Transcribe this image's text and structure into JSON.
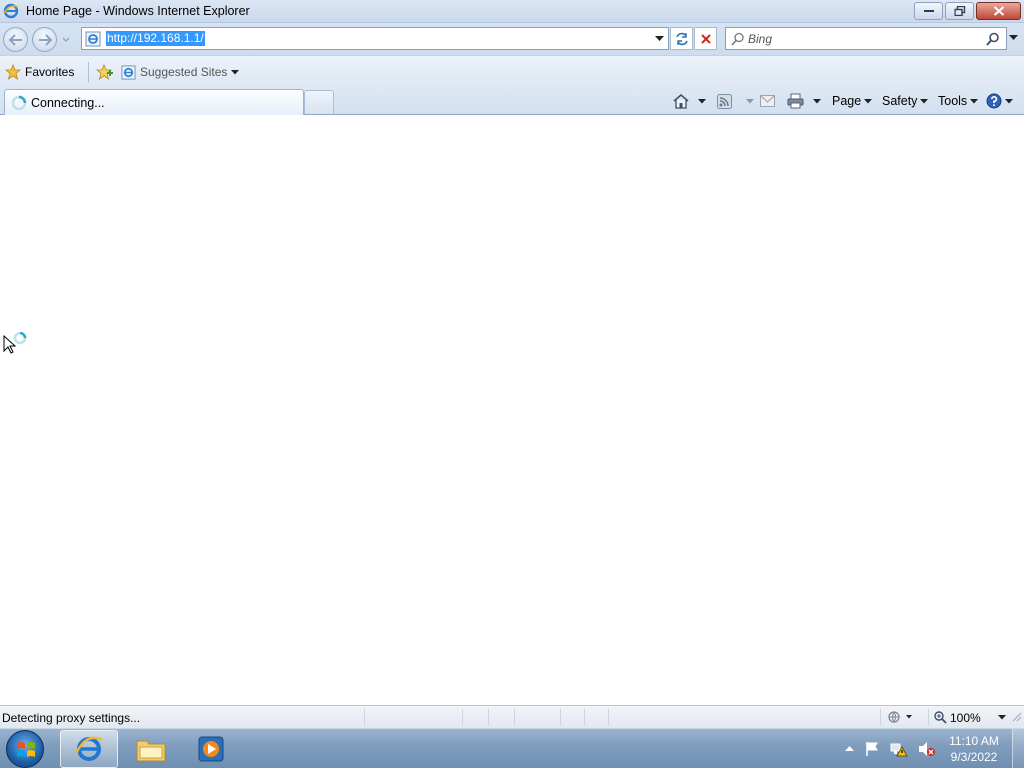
{
  "window": {
    "title": "Home Page - Windows Internet Explorer",
    "minimize_icon": "minimize-icon",
    "restore_icon": "restore-icon",
    "close_icon": "close-icon"
  },
  "navigation": {
    "back_icon": "back-arrow-icon",
    "forward_icon": "forward-arrow-icon",
    "address_url": "http://192.168.1.1/",
    "refresh_icon": "refresh-icon",
    "stop_icon": "stop-icon",
    "search_placeholder": "Bing"
  },
  "favorites_bar": {
    "favorites_label": "Favorites",
    "suggested_sites_label": "Suggested Sites"
  },
  "tabs": [
    {
      "label": "Connecting...",
      "active": true
    }
  ],
  "command_bar": {
    "page_label": "Page",
    "safety_label": "Safety",
    "tools_label": "Tools"
  },
  "status_bar": {
    "status_text": "Detecting proxy settings...",
    "zoom_level": "100%"
  },
  "taskbar": {
    "clock_time": "11:10 AM",
    "clock_date": "9/3/2022",
    "pinned_apps": [
      "internet-explorer",
      "windows-explorer",
      "windows-media-player"
    ]
  },
  "colors": {
    "url_selection": "#3399ff",
    "chrome_blue": "#d6e3f2",
    "close_button": "#c24734"
  }
}
